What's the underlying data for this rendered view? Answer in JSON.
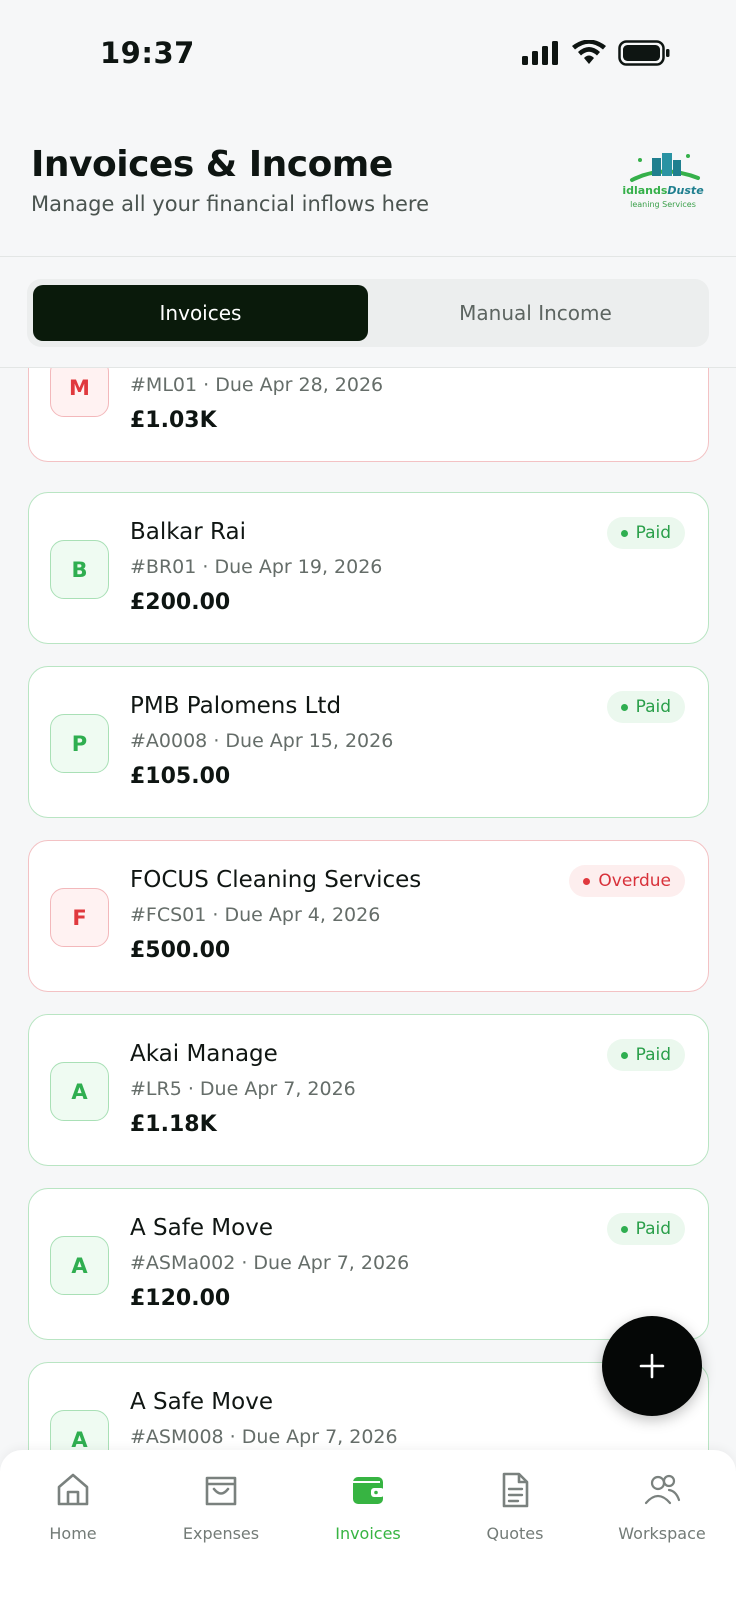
{
  "status_bar": {
    "time": "19:37"
  },
  "header": {
    "title": "Invoices & Income",
    "subtitle": "Manage all your financial inflows here",
    "logo_brand_a": "idlands",
    "logo_brand_b": "Duste",
    "logo_sub": "leaning Services"
  },
  "tabs": [
    {
      "label": "Invoices",
      "active": true
    },
    {
      "label": "Manual Income",
      "active": false
    }
  ],
  "invoices": [
    {
      "initial": "M",
      "client": "",
      "ref": "#ML01",
      "due": "Due Apr 28, 2026",
      "amount": "£1.03K",
      "status": "",
      "state": "overdue"
    },
    {
      "initial": "B",
      "client": "Balkar Rai",
      "ref": "#BR01",
      "due": "Due Apr 19, 2026",
      "amount": "£200.00",
      "status": "Paid",
      "state": "paid"
    },
    {
      "initial": "P",
      "client": "PMB Palomens Ltd",
      "ref": "#A0008",
      "due": "Due Apr 15, 2026",
      "amount": "£105.00",
      "status": "Paid",
      "state": "paid"
    },
    {
      "initial": "F",
      "client": "FOCUS Cleaning Services",
      "ref": "#FCS01",
      "due": "Due Apr 4, 2026",
      "amount": "£500.00",
      "status": "Overdue",
      "state": "overdue"
    },
    {
      "initial": "A",
      "client": "Akai Manage",
      "ref": "#LR5",
      "due": "Due Apr 7, 2026",
      "amount": "£1.18K",
      "status": "Paid",
      "state": "paid"
    },
    {
      "initial": "A",
      "client": "A Safe Move",
      "ref": "#ASMa002",
      "due": "Due Apr 7, 2026",
      "amount": "£120.00",
      "status": "Paid",
      "state": "paid"
    },
    {
      "initial": "A",
      "client": "A Safe Move",
      "ref": "#ASM008",
      "due": "Due Apr 7, 2026",
      "amount": "",
      "status": "",
      "state": "paid"
    }
  ],
  "fab": {
    "icon": "plus-icon"
  },
  "bottom_nav": [
    {
      "label": "Home",
      "icon": "home-icon",
      "active": false
    },
    {
      "label": "Expenses",
      "icon": "shopping-bag-icon",
      "active": false
    },
    {
      "label": "Invoices",
      "icon": "wallet-icon",
      "active": true
    },
    {
      "label": "Quotes",
      "icon": "document-icon",
      "active": false
    },
    {
      "label": "Workspace",
      "icon": "users-icon",
      "active": false
    }
  ],
  "colors": {
    "accent_green": "#37b442",
    "paid_green": "#2fae50",
    "overdue_red": "#e0393e",
    "tab_active_bg": "#0a1a0b"
  }
}
